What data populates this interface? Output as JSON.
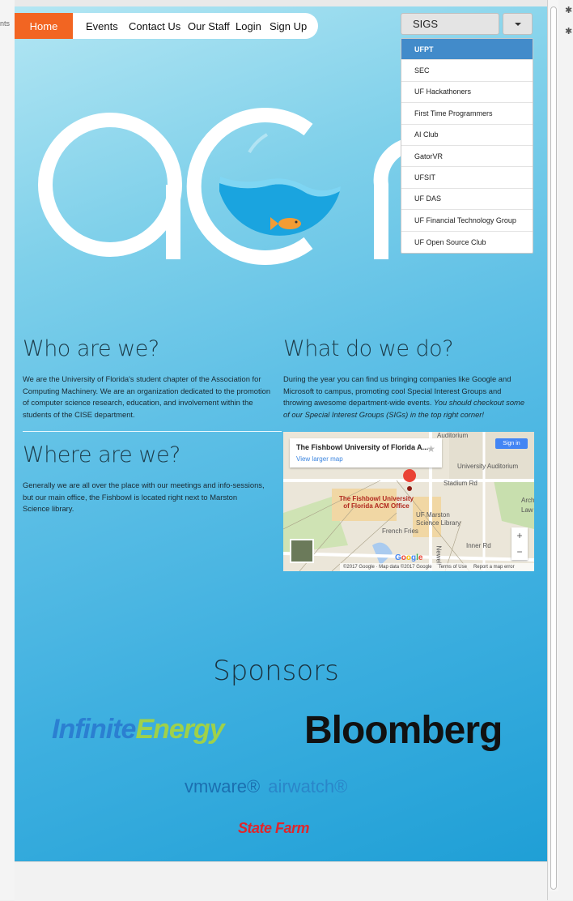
{
  "chrome": {
    "left_fragment": "nts"
  },
  "nav": {
    "home": "Home",
    "events": "Events",
    "contact": "Contact Us",
    "staff": "Our Staff",
    "login": "Login",
    "signup": "Sign Up"
  },
  "dropdown": {
    "label": "SIGS",
    "items": [
      "UFPT",
      "SEC",
      "UF Hackathoners",
      "First Time Programmers",
      "AI Club",
      "GatorVR",
      "UFSIT",
      "UF DAS",
      "UF Financial Technology Group",
      "UF Open Source Club"
    ]
  },
  "who": {
    "heading": "Who are we?",
    "text": "We are the University of Florida's student chapter of the Association for Computing Machinery. We are an organization dedicated to the promotion of computer science research, education, and involvement within the students of the CISE department."
  },
  "what": {
    "heading": "What do we do?",
    "text": "During the year you can find us bringing companies like Google and Microsoft to campus, promoting cool Special Interest Groups and throwing awesome department-wide events. ",
    "italic": "You should checkout some of our Special Interest Groups (SIGs) in the top right corner!"
  },
  "where": {
    "heading": "Where are we?",
    "text": "Generally we are all over the place with our meetings and info-sessions, but our main office, the Fishbowl is located right next to Marston Science library."
  },
  "map": {
    "title": "The Fishbowl University of Florida A...",
    "larger": "View larger map",
    "signin": "Sign in",
    "marker_label_1": "The Fishbowl University",
    "marker_label_2": "of Florida ACM Office",
    "auditorium": "University Auditorium",
    "stadium": "Stadium Rd",
    "library_1": "UF Marston",
    "library_2": "Science Library",
    "fries": "French Fries",
    "inner": "Inner Rd",
    "auditorium_top": "Auditorium",
    "archi": "Archite",
    "law": "Law",
    "newell": "Newell",
    "google": "Google",
    "attribution": "©2017 Google · Map data ©2017 Google",
    "terms": "Terms of Use",
    "report": "Report a map error"
  },
  "sponsors": {
    "heading": "Sponsors",
    "infinite_a": "Infinite",
    "infinite_b": "Energy",
    "bloomberg": "Bloomberg",
    "vmware": "vmware®",
    "airwatch": "airwatch®",
    "statefarm": "State Farm"
  }
}
